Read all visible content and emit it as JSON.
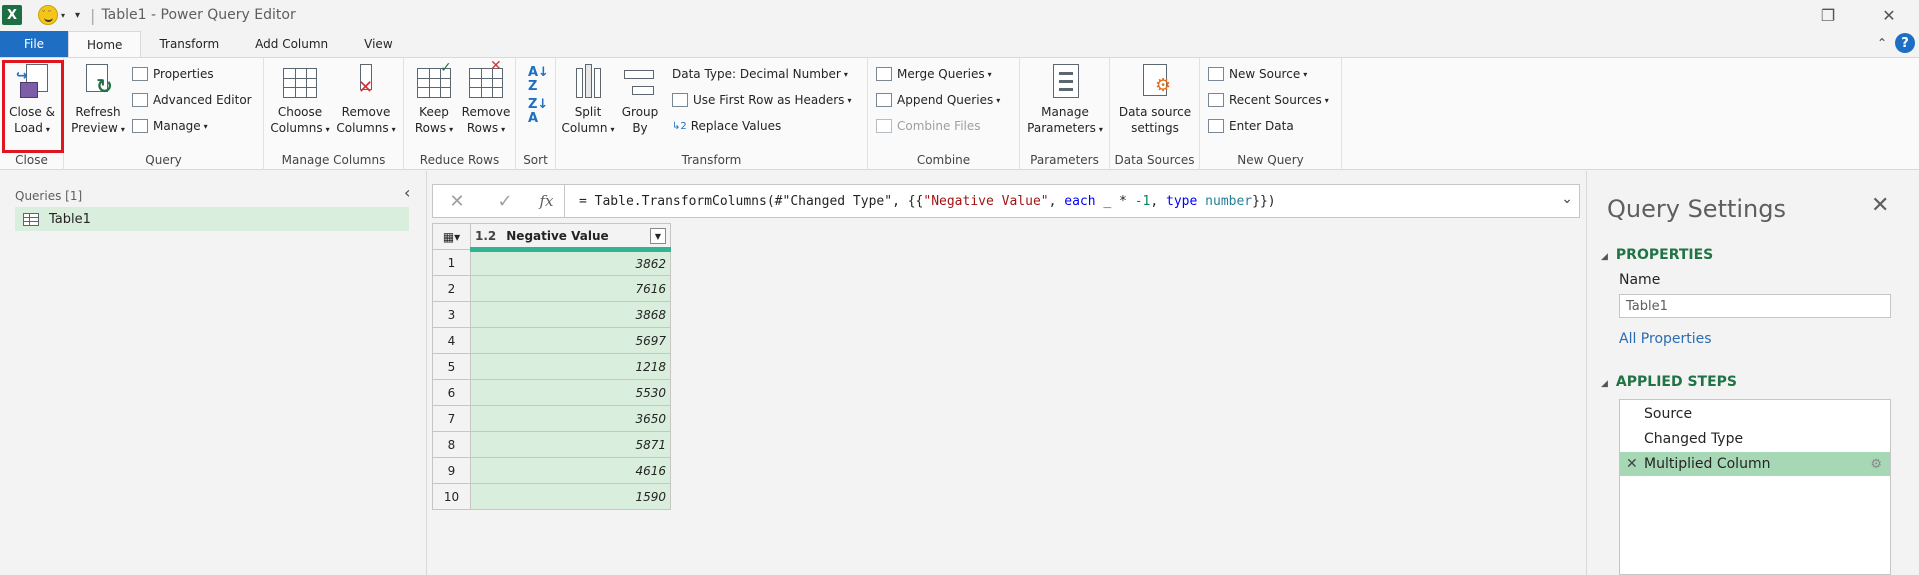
{
  "window": {
    "title": "Table1 - Power Query Editor",
    "app_icon": "X",
    "controls": {
      "restore": "❐",
      "close": "✕"
    }
  },
  "tabs": [
    {
      "label": "File"
    },
    {
      "label": "Home"
    },
    {
      "label": "Transform"
    },
    {
      "label": "Add Column"
    },
    {
      "label": "View"
    }
  ],
  "ribbon": {
    "close_group": {
      "label": "Close",
      "close_load": [
        "Close &",
        "Load"
      ]
    },
    "query_group": {
      "label": "Query",
      "refresh": [
        "Refresh",
        "Preview"
      ],
      "properties": "Properties",
      "advanced_editor": "Advanced Editor",
      "manage": "Manage"
    },
    "manage_columns_group": {
      "label": "Manage Columns",
      "choose": [
        "Choose",
        "Columns"
      ],
      "remove": [
        "Remove",
        "Columns"
      ]
    },
    "reduce_rows_group": {
      "label": "Reduce Rows",
      "keep": [
        "Keep",
        "Rows"
      ],
      "remove": [
        "Remove",
        "Rows"
      ]
    },
    "sort_group": {
      "label": "Sort"
    },
    "transform_group": {
      "label": "Transform",
      "split": [
        "Split",
        "Column"
      ],
      "group_by": [
        "Group",
        "By"
      ],
      "data_type": "Data Type: Decimal Number",
      "first_row": "Use First Row as Headers",
      "replace": "Replace Values"
    },
    "combine_group": {
      "label": "Combine",
      "merge": "Merge Queries",
      "append": "Append Queries",
      "combine_files": "Combine Files"
    },
    "parameters_group": {
      "label": "Parameters",
      "manage": [
        "Manage",
        "Parameters"
      ]
    },
    "data_sources_group": {
      "label": "Data Sources",
      "settings": [
        "Data source",
        "settings"
      ]
    },
    "new_query_group": {
      "label": "New Query",
      "new_source": "New Source",
      "recent_sources": "Recent Sources",
      "enter_data": "Enter Data"
    }
  },
  "queries": {
    "header": "Queries [1]",
    "items": [
      {
        "label": "Table1"
      }
    ]
  },
  "formula_bar": {
    "fx": "fx",
    "prefix": "= Table.TransformColumns(#\"Changed Type\", {{",
    "str": "\"Negative Value\"",
    "sep1": ", ",
    "kw1": "each",
    "mid": " _ * ",
    "num": "-1",
    "sep2": ", ",
    "kw2": "type",
    "sp": " ",
    "typ": "number",
    "suffix": "}})"
  },
  "table": {
    "column": {
      "type": "1.2",
      "name": "Negative Value"
    },
    "rows": [
      {
        "n": "1",
        "v": "3862"
      },
      {
        "n": "2",
        "v": "7616"
      },
      {
        "n": "3",
        "v": "3868"
      },
      {
        "n": "4",
        "v": "5697"
      },
      {
        "n": "5",
        "v": "1218"
      },
      {
        "n": "6",
        "v": "5530"
      },
      {
        "n": "7",
        "v": "3650"
      },
      {
        "n": "8",
        "v": "5871"
      },
      {
        "n": "9",
        "v": "4616"
      },
      {
        "n": "10",
        "v": "1590"
      }
    ]
  },
  "settings": {
    "title": "Query Settings",
    "properties_header": "PROPERTIES",
    "name_label": "Name",
    "name_value": "Table1",
    "all_properties": "All Properties",
    "steps_header": "APPLIED STEPS",
    "steps": [
      {
        "label": "Source"
      },
      {
        "label": "Changed Type"
      },
      {
        "label": "Multiplied Column"
      }
    ]
  },
  "colors": {
    "accent": "#217346",
    "file_tab": "#1e6fc4",
    "selection": "#d9eedd",
    "highlight_box": "#e0151f"
  }
}
